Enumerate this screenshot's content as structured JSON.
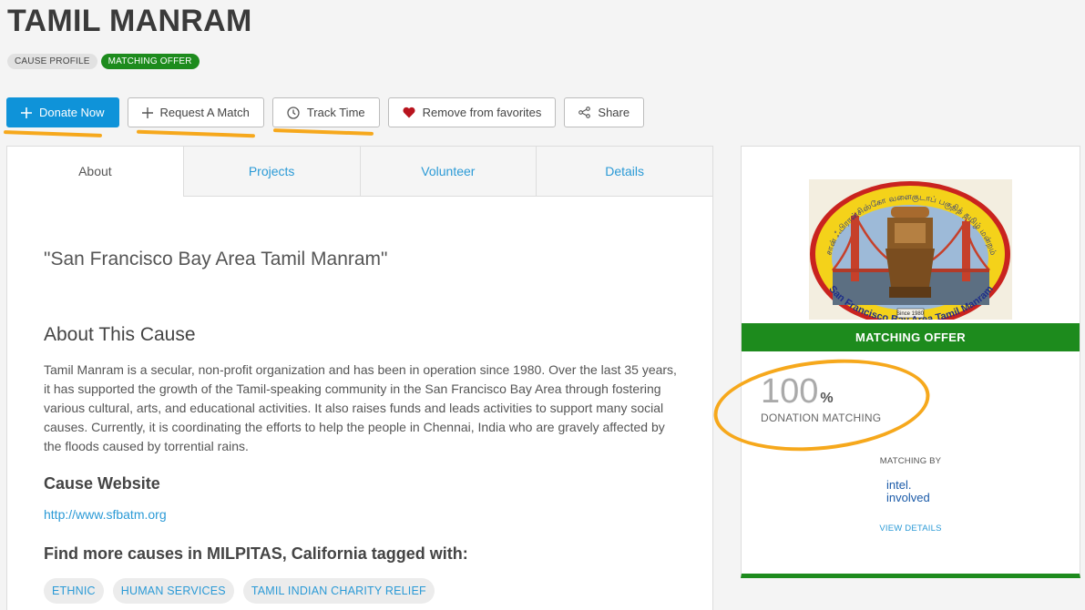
{
  "page": {
    "title": "TAMIL MANRAM"
  },
  "badges": {
    "profile": "CAUSE PROFILE",
    "matching": "MATCHING OFFER"
  },
  "actions": {
    "donate": "Donate Now",
    "request_match": "Request A Match",
    "track_time": "Track Time",
    "remove_favorites": "Remove from favorites",
    "share": "Share"
  },
  "tabs": [
    {
      "label": "About"
    },
    {
      "label": "Projects"
    },
    {
      "label": "Volunteer"
    },
    {
      "label": "Details"
    }
  ],
  "about": {
    "quote": "\"San Francisco Bay Area Tamil Manram\"",
    "heading": "About This Cause",
    "description": "Tamil Manram is a secular, non-profit organization and has been in operation since 1980. Over the last 35 years, it has supported the growth of the Tamil-speaking community in the San Francisco Bay Area through fostering various cultural, arts, and educational activities. It also raises funds and leads activities to support many social causes. Currently, it is coordinating the efforts to help the people in Chennai, India who are gravely affected by the floods caused by torrential rains.",
    "website_heading": "Cause Website",
    "website_url": "http://www.sfbatm.org",
    "tags_heading": "Find more causes in MILPITAS, California tagged with:",
    "tags": [
      "ETHNIC",
      "HUMAN SERVICES",
      "TAMIL INDIAN CHARITY RELIEF"
    ]
  },
  "sidebar": {
    "logo_top_text": "சான் ஃபிரான்சிஸ்கோ வளைகுடாப் பகுதித் தமிழ் மன்றம்",
    "logo_bottom_text": "San Francisco Bay Area Tamil Manram",
    "logo_since": "Since 1980",
    "offer_label": "MATCHING OFFER",
    "match_percent": "100",
    "percent_symbol": "%",
    "match_label": "DONATION MATCHING",
    "matching_by": "MATCHING BY",
    "sponsor_line1": "intel.",
    "sponsor_line2": "involved",
    "view_details": "VIEW DETAILS"
  },
  "colors": {
    "primary": "#0f93d9",
    "green": "#1d8b1d",
    "link": "#2b9ad6",
    "highlight": "#f6a81c",
    "heart": "#b8141e"
  }
}
